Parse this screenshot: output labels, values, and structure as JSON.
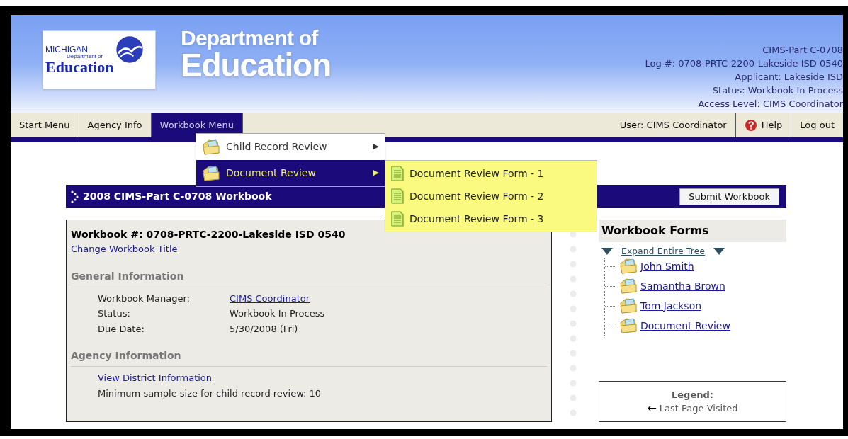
{
  "header": {
    "logo": {
      "top": "MICHIGAN",
      "small": "Department of",
      "bottom": "Education"
    },
    "title_top": "Department of",
    "title_bottom": "Education",
    "info": [
      "CIMS-Part C-0708",
      "Log #: 0708-PRTC-2200-Lakeside ISD 0540",
      "Applicant: Lakeside ISD",
      "Status: Workbook In Process",
      "Access Level: CIMS Coordinator"
    ]
  },
  "nav": {
    "tabs": [
      {
        "label": "Start Menu",
        "selected": false
      },
      {
        "label": "Agency Info",
        "selected": false
      },
      {
        "label": "Workbook Menu",
        "selected": true
      }
    ],
    "user": "User: CIMS Coordinator",
    "help": "Help",
    "logout": "Log out"
  },
  "dropdown": {
    "items": [
      {
        "label": "Child Record Review",
        "selected": false,
        "arrow": "▶"
      },
      {
        "label": "Document Review",
        "selected": true,
        "arrow": "▶"
      }
    ]
  },
  "submenu": {
    "items": [
      "Document Review Form - 1",
      "Document Review Form - 2",
      "Document Review Form - 3"
    ]
  },
  "workbook": {
    "title": "2008 CIMS-Part C-0708 Workbook",
    "submit": "Submit Workbook",
    "number": "Workbook #: 0708-PRTC-2200-Lakeside ISD 0540",
    "change_title": "Change Workbook Title",
    "sections": [
      {
        "title": "General Information",
        "rows": [
          {
            "kind": "field",
            "label": "Workbook Manager:",
            "value": "CIMS Coordinator",
            "link": true
          },
          {
            "kind": "field",
            "label": "Status:",
            "value": "Workbook In Process",
            "link": false
          },
          {
            "kind": "field",
            "label": "Due Date:",
            "value": "5/30/2008 (Fri)",
            "link": false
          }
        ]
      },
      {
        "title": "Agency Information",
        "rows": [
          {
            "kind": "link",
            "text": "View District Information"
          },
          {
            "kind": "text",
            "text": "Minimum sample size for child record review: 10"
          }
        ]
      }
    ]
  },
  "forms": {
    "title": "Workbook Forms",
    "expand": "Expand Entire Tree",
    "items": [
      "John Smith",
      "Samantha Brown",
      "Tom Jackson",
      "Document Review"
    ],
    "legend": {
      "title": "Legend:",
      "item": "Last Page Visited",
      "arrow": "←"
    }
  }
}
